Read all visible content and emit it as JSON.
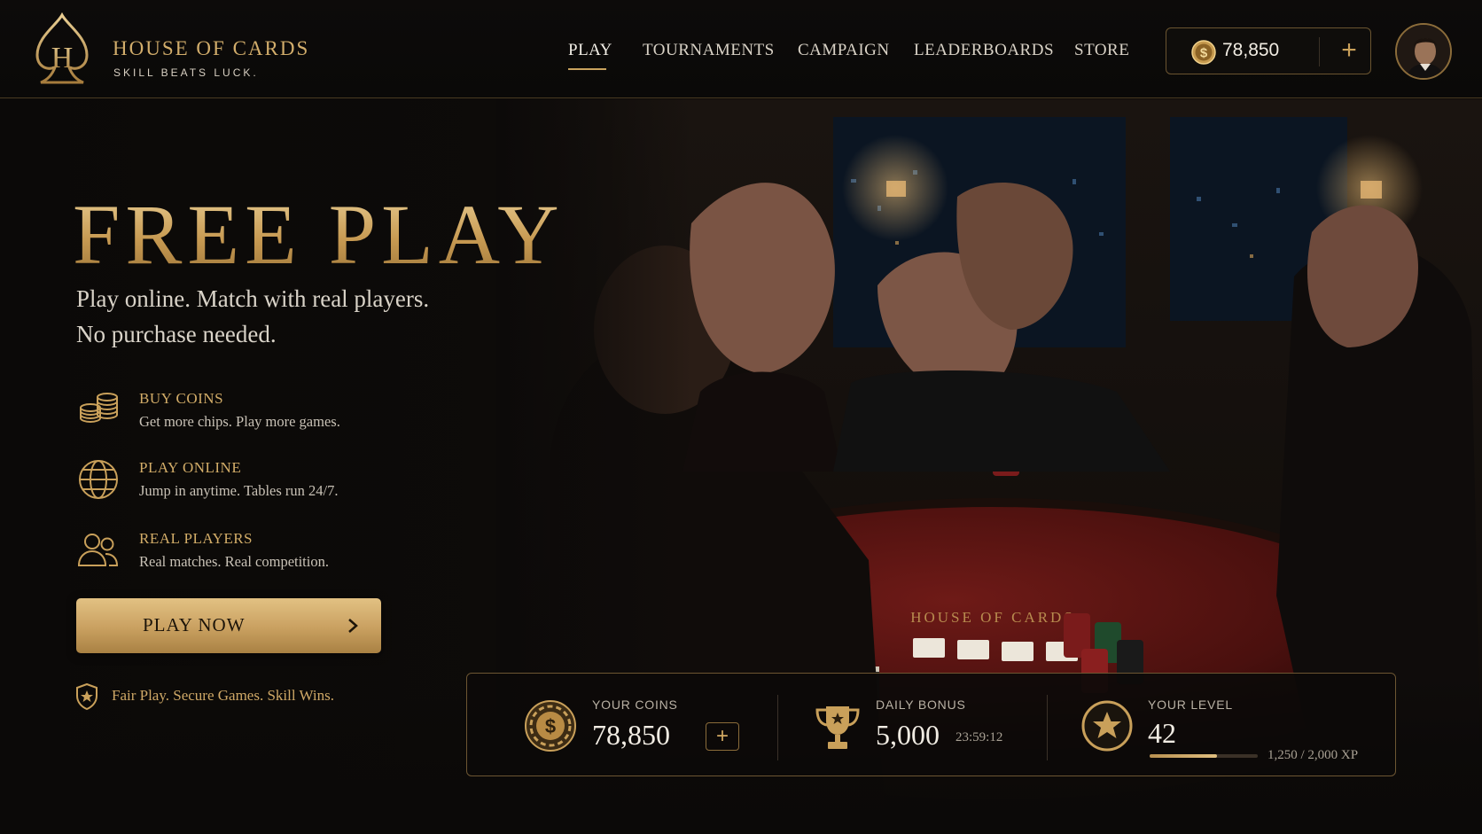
{
  "brand": {
    "title": "HOUSE OF CARDS",
    "tagline": "SKILL BEATS LUCK.",
    "mark_letter": "H",
    "accent_color": "#c9a05a"
  },
  "nav": {
    "items": [
      {
        "label": "PLAY",
        "active": true
      },
      {
        "label": "TOURNAMENTS",
        "active": false
      },
      {
        "label": "CAMPAIGN",
        "active": false
      },
      {
        "label": "LEADERBOARDS",
        "active": false
      },
      {
        "label": "STORE",
        "active": false
      }
    ]
  },
  "wallet": {
    "balance": "78,850",
    "coin_icon": "dollar-coin-icon",
    "add_icon": "plus-icon"
  },
  "profile": {
    "avatar_icon": "user-avatar"
  },
  "hero": {
    "title": "FREE PLAY",
    "subtitle_line1": "Play online. Match with real players.",
    "subtitle_line2": "No purchase needed.",
    "table_text": "HOUSE OF CARDS",
    "features": [
      {
        "icon": "coin-stack-icon",
        "title": "BUY COINS",
        "desc": "Get more chips. Play more games."
      },
      {
        "icon": "globe-icon",
        "title": "PLAY ONLINE",
        "desc": "Jump in anytime. Tables run 24/7."
      },
      {
        "icon": "users-icon",
        "title": "REAL PLAYERS",
        "desc": "Real matches. Real competition."
      }
    ],
    "cta_label": "PLAY NOW",
    "fair_play": "Fair Play. Secure Games. Skill Wins."
  },
  "stats": {
    "coins": {
      "label": "YOUR COINS",
      "value": "78,850",
      "icon": "coin-icon"
    },
    "daily_bonus": {
      "label": "DAILY BONUS",
      "value": "5,000",
      "timer": "23:59:12",
      "icon": "trophy-icon"
    },
    "level": {
      "label": "YOUR LEVEL",
      "value": "42",
      "xp_text": "1,250 / 2,000 XP",
      "xp_progress": 0.625,
      "icon": "star-badge-icon"
    }
  }
}
